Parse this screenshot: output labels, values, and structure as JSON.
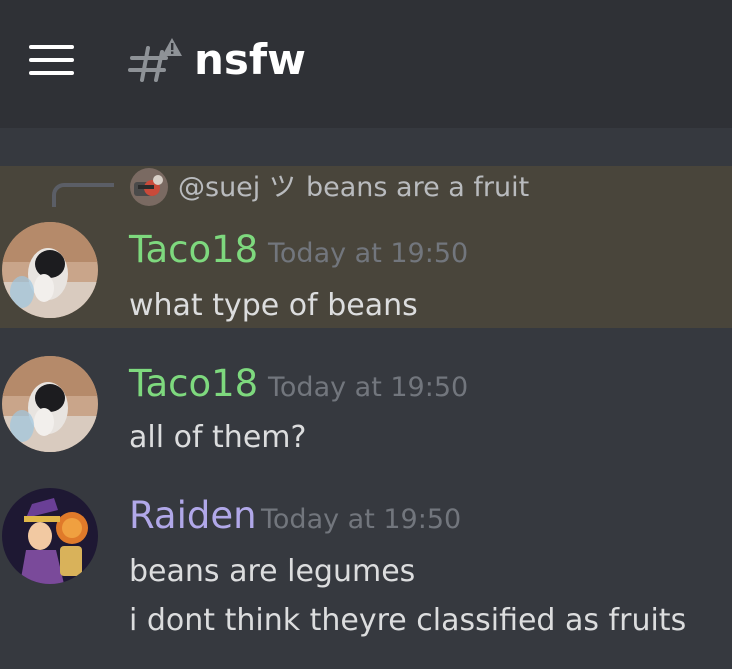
{
  "header": {
    "channel_name": "nsfw",
    "menu_icon": "hamburger-menu-icon",
    "channel_icon": "nsfw-text-channel-icon"
  },
  "reply": {
    "author": "@suej ツ",
    "text": "beans are a fruit"
  },
  "messages": [
    {
      "author": "Taco18",
      "author_color": "#7ed97e",
      "timestamp": "Today at 19:50",
      "lines": [
        "what type of beans"
      ],
      "highlighted": true
    },
    {
      "author": "Taco18",
      "author_color": "#7ed97e",
      "timestamp": "Today at 19:50",
      "lines": [
        "all of them?"
      ]
    },
    {
      "author": "Raiden",
      "author_color": "#b1a8e9",
      "timestamp": "Today at 19:50",
      "lines": [
        "beans are legumes",
        "i dont think theyre classified as fruits"
      ]
    }
  ],
  "colors": {
    "background": "#36393f",
    "header_bg": "#2f3136",
    "highlight_bg": "#49453b",
    "text": "#dcddde",
    "timestamp": "#72767d"
  }
}
